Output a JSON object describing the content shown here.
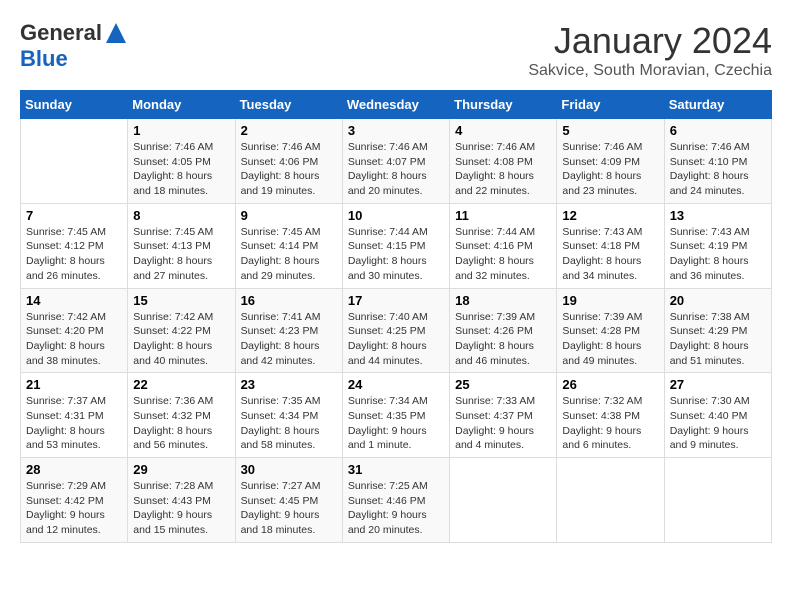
{
  "header": {
    "logo_line1": "General",
    "logo_line2": "Blue",
    "title": "January 2024",
    "subtitle": "Sakvice, South Moravian, Czechia"
  },
  "weekdays": [
    "Sunday",
    "Monday",
    "Tuesday",
    "Wednesday",
    "Thursday",
    "Friday",
    "Saturday"
  ],
  "weeks": [
    [
      {
        "day": "",
        "sunrise": "",
        "sunset": "",
        "daylight": ""
      },
      {
        "day": "1",
        "sunrise": "Sunrise: 7:46 AM",
        "sunset": "Sunset: 4:05 PM",
        "daylight": "Daylight: 8 hours and 18 minutes."
      },
      {
        "day": "2",
        "sunrise": "Sunrise: 7:46 AM",
        "sunset": "Sunset: 4:06 PM",
        "daylight": "Daylight: 8 hours and 19 minutes."
      },
      {
        "day": "3",
        "sunrise": "Sunrise: 7:46 AM",
        "sunset": "Sunset: 4:07 PM",
        "daylight": "Daylight: 8 hours and 20 minutes."
      },
      {
        "day": "4",
        "sunrise": "Sunrise: 7:46 AM",
        "sunset": "Sunset: 4:08 PM",
        "daylight": "Daylight: 8 hours and 22 minutes."
      },
      {
        "day": "5",
        "sunrise": "Sunrise: 7:46 AM",
        "sunset": "Sunset: 4:09 PM",
        "daylight": "Daylight: 8 hours and 23 minutes."
      },
      {
        "day": "6",
        "sunrise": "Sunrise: 7:46 AM",
        "sunset": "Sunset: 4:10 PM",
        "daylight": "Daylight: 8 hours and 24 minutes."
      }
    ],
    [
      {
        "day": "7",
        "sunrise": "Sunrise: 7:45 AM",
        "sunset": "Sunset: 4:12 PM",
        "daylight": "Daylight: 8 hours and 26 minutes."
      },
      {
        "day": "8",
        "sunrise": "Sunrise: 7:45 AM",
        "sunset": "Sunset: 4:13 PM",
        "daylight": "Daylight: 8 hours and 27 minutes."
      },
      {
        "day": "9",
        "sunrise": "Sunrise: 7:45 AM",
        "sunset": "Sunset: 4:14 PM",
        "daylight": "Daylight: 8 hours and 29 minutes."
      },
      {
        "day": "10",
        "sunrise": "Sunrise: 7:44 AM",
        "sunset": "Sunset: 4:15 PM",
        "daylight": "Daylight: 8 hours and 30 minutes."
      },
      {
        "day": "11",
        "sunrise": "Sunrise: 7:44 AM",
        "sunset": "Sunset: 4:16 PM",
        "daylight": "Daylight: 8 hours and 32 minutes."
      },
      {
        "day": "12",
        "sunrise": "Sunrise: 7:43 AM",
        "sunset": "Sunset: 4:18 PM",
        "daylight": "Daylight: 8 hours and 34 minutes."
      },
      {
        "day": "13",
        "sunrise": "Sunrise: 7:43 AM",
        "sunset": "Sunset: 4:19 PM",
        "daylight": "Daylight: 8 hours and 36 minutes."
      }
    ],
    [
      {
        "day": "14",
        "sunrise": "Sunrise: 7:42 AM",
        "sunset": "Sunset: 4:20 PM",
        "daylight": "Daylight: 8 hours and 38 minutes."
      },
      {
        "day": "15",
        "sunrise": "Sunrise: 7:42 AM",
        "sunset": "Sunset: 4:22 PM",
        "daylight": "Daylight: 8 hours and 40 minutes."
      },
      {
        "day": "16",
        "sunrise": "Sunrise: 7:41 AM",
        "sunset": "Sunset: 4:23 PM",
        "daylight": "Daylight: 8 hours and 42 minutes."
      },
      {
        "day": "17",
        "sunrise": "Sunrise: 7:40 AM",
        "sunset": "Sunset: 4:25 PM",
        "daylight": "Daylight: 8 hours and 44 minutes."
      },
      {
        "day": "18",
        "sunrise": "Sunrise: 7:39 AM",
        "sunset": "Sunset: 4:26 PM",
        "daylight": "Daylight: 8 hours and 46 minutes."
      },
      {
        "day": "19",
        "sunrise": "Sunrise: 7:39 AM",
        "sunset": "Sunset: 4:28 PM",
        "daylight": "Daylight: 8 hours and 49 minutes."
      },
      {
        "day": "20",
        "sunrise": "Sunrise: 7:38 AM",
        "sunset": "Sunset: 4:29 PM",
        "daylight": "Daylight: 8 hours and 51 minutes."
      }
    ],
    [
      {
        "day": "21",
        "sunrise": "Sunrise: 7:37 AM",
        "sunset": "Sunset: 4:31 PM",
        "daylight": "Daylight: 8 hours and 53 minutes."
      },
      {
        "day": "22",
        "sunrise": "Sunrise: 7:36 AM",
        "sunset": "Sunset: 4:32 PM",
        "daylight": "Daylight: 8 hours and 56 minutes."
      },
      {
        "day": "23",
        "sunrise": "Sunrise: 7:35 AM",
        "sunset": "Sunset: 4:34 PM",
        "daylight": "Daylight: 8 hours and 58 minutes."
      },
      {
        "day": "24",
        "sunrise": "Sunrise: 7:34 AM",
        "sunset": "Sunset: 4:35 PM",
        "daylight": "Daylight: 9 hours and 1 minute."
      },
      {
        "day": "25",
        "sunrise": "Sunrise: 7:33 AM",
        "sunset": "Sunset: 4:37 PM",
        "daylight": "Daylight: 9 hours and 4 minutes."
      },
      {
        "day": "26",
        "sunrise": "Sunrise: 7:32 AM",
        "sunset": "Sunset: 4:38 PM",
        "daylight": "Daylight: 9 hours and 6 minutes."
      },
      {
        "day": "27",
        "sunrise": "Sunrise: 7:30 AM",
        "sunset": "Sunset: 4:40 PM",
        "daylight": "Daylight: 9 hours and 9 minutes."
      }
    ],
    [
      {
        "day": "28",
        "sunrise": "Sunrise: 7:29 AM",
        "sunset": "Sunset: 4:42 PM",
        "daylight": "Daylight: 9 hours and 12 minutes."
      },
      {
        "day": "29",
        "sunrise": "Sunrise: 7:28 AM",
        "sunset": "Sunset: 4:43 PM",
        "daylight": "Daylight: 9 hours and 15 minutes."
      },
      {
        "day": "30",
        "sunrise": "Sunrise: 7:27 AM",
        "sunset": "Sunset: 4:45 PM",
        "daylight": "Daylight: 9 hours and 18 minutes."
      },
      {
        "day": "31",
        "sunrise": "Sunrise: 7:25 AM",
        "sunset": "Sunset: 4:46 PM",
        "daylight": "Daylight: 9 hours and 20 minutes."
      },
      {
        "day": "",
        "sunrise": "",
        "sunset": "",
        "daylight": ""
      },
      {
        "day": "",
        "sunrise": "",
        "sunset": "",
        "daylight": ""
      },
      {
        "day": "",
        "sunrise": "",
        "sunset": "",
        "daylight": ""
      }
    ]
  ]
}
